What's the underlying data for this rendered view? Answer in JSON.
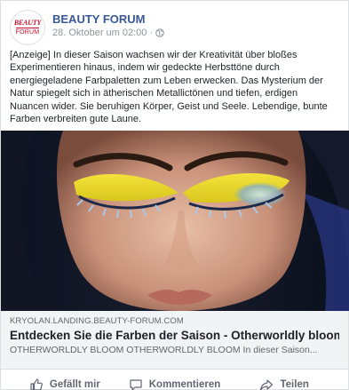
{
  "header": {
    "page_name": "BEAUTY FORUM",
    "logo_text_top": "BEAUTY",
    "logo_text_bottom": "FORUM",
    "timestamp": "28. Oktober um 02:00 ·",
    "privacy_icon": "globe-icon"
  },
  "post": {
    "text": "[Anzeige] In dieser Saison wachsen wir der Kreativität über bloßes Experimentieren hinaus, indem wir gedeckte Herbsttöne durch energiegeladene Farbpaletten zum Leben erwecken. Das Mysterium der Natur spiegelt sich in ätherischen Metallictönen und tiefen, erdigen Nuancen wider. Sie beruhigen Körper, Geist und Seele. Lebendige, bunte Farben verbreiten gute Laune."
  },
  "link": {
    "domain": "KRYOLAN.LANDING.BEAUTY-FORUM.COM",
    "title": "Entdecken Sie die Farben der Saison - Otherworldly bloom",
    "description": "OTHERWORLDLY BLOOM OTHERWORLDLY BLOOM In dieser Saison..."
  },
  "actions": {
    "like_label": "Gefällt mir",
    "comment_label": "Kommentieren",
    "share_label": "Teilen",
    "like_icon": "thumbs-up-icon",
    "comment_icon": "speech-bubble-icon",
    "share_icon": "share-arrow-icon"
  },
  "colors": {
    "page_name": "#385898",
    "logo_red": "#c8102e",
    "link_background": "#f2f3f5",
    "muted_text": "#606770"
  }
}
